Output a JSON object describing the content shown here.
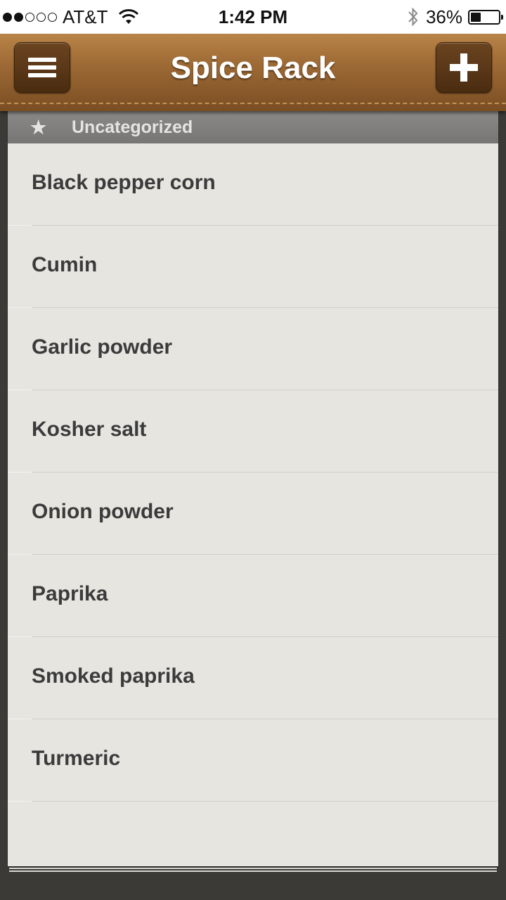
{
  "status_bar": {
    "carrier": "AT&T",
    "time": "1:42 PM",
    "battery_percent": "36%",
    "battery_level": 0.36,
    "signal_bars_filled": 2,
    "signal_bars_total": 5
  },
  "header": {
    "title": "Spice Rack",
    "menu_icon": "hamburger-menu-icon",
    "add_icon": "plus-icon"
  },
  "section": {
    "star_icon": "★",
    "label": "Uncategorized"
  },
  "items": [
    {
      "label": "Black pepper corn"
    },
    {
      "label": "Cumin"
    },
    {
      "label": "Garlic powder"
    },
    {
      "label": "Kosher salt"
    },
    {
      "label": "Onion powder"
    },
    {
      "label": "Paprika"
    },
    {
      "label": "Smoked paprika"
    },
    {
      "label": "Turmeric"
    }
  ],
  "colors": {
    "header_leather": "#9d6a35",
    "paper": "#e6e5e0",
    "section_header": "#808080",
    "text": "#3b3b3b"
  }
}
